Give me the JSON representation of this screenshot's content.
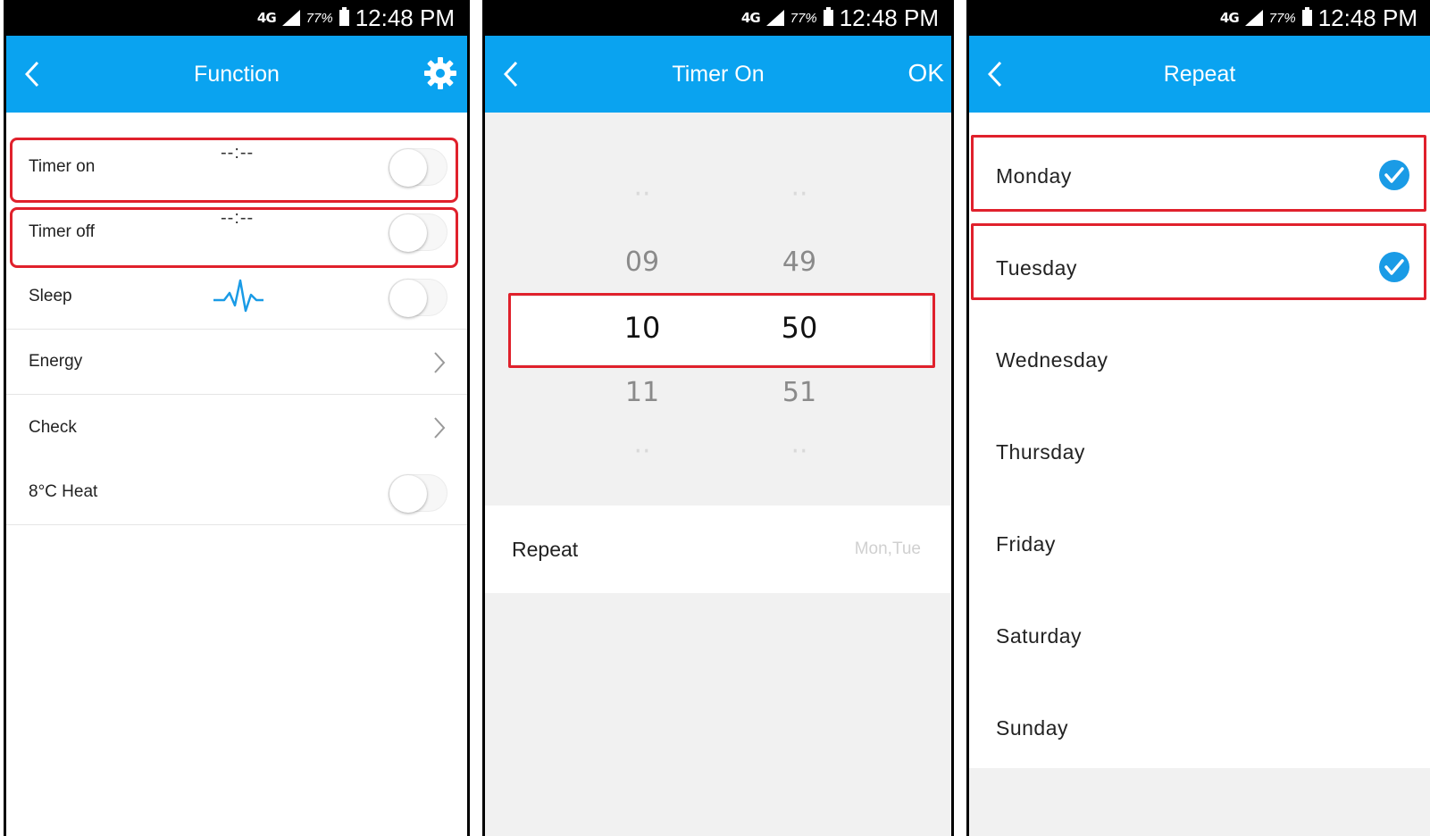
{
  "status": {
    "network": "4G",
    "battery": "77%",
    "time": "12:48 PM"
  },
  "function_screen": {
    "title": "Function",
    "rows": [
      {
        "label": "Timer on",
        "value": "--:--"
      },
      {
        "label": "Timer off",
        "value": "--:--"
      },
      {
        "label": "Sleep"
      },
      {
        "label": "Energy"
      },
      {
        "label": "Check"
      },
      {
        "label": "8°C Heat"
      }
    ]
  },
  "timer_screen": {
    "title": "Timer On",
    "ok_label": "OK",
    "hours": {
      "above": "09",
      "selected": "10",
      "below": "11"
    },
    "minutes": {
      "above": "49",
      "selected": "50",
      "below": "51"
    },
    "repeat_label": "Repeat",
    "repeat_value": "Mon,Tue"
  },
  "repeat_screen": {
    "title": "Repeat",
    "days": [
      {
        "label": "Monday",
        "checked": true
      },
      {
        "label": "Tuesday",
        "checked": true
      },
      {
        "label": "Wednesday",
        "checked": false
      },
      {
        "label": "Thursday",
        "checked": false
      },
      {
        "label": "Friday",
        "checked": false
      },
      {
        "label": "Saturday",
        "checked": false
      },
      {
        "label": "Sunday",
        "checked": false
      }
    ]
  },
  "colors": {
    "accent": "#0aa3f0",
    "highlight": "#e0212c"
  }
}
